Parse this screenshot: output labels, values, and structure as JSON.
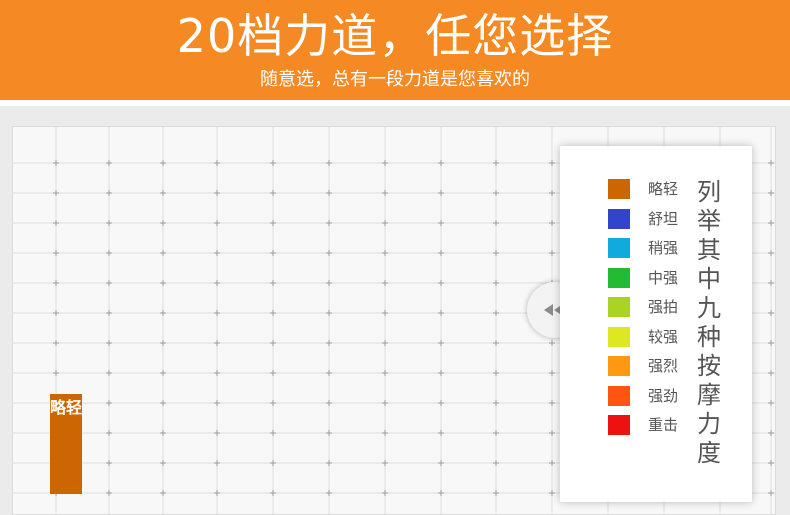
{
  "banner": {
    "title": "20档力道，任您选择",
    "subtitle": "随意选，总有一段力道是您喜欢的",
    "color": "#f58a25"
  },
  "level_bar": {
    "label": "略轻",
    "color": "#cc6600"
  },
  "legend": {
    "caption": "列举其中九种按摩力度",
    "items": [
      {
        "label": "略轻",
        "color": "#cc6600"
      },
      {
        "label": "舒坦",
        "color": "#3344cc"
      },
      {
        "label": "稍强",
        "color": "#11aadd"
      },
      {
        "label": "中强",
        "color": "#22bb33"
      },
      {
        "label": "强拍",
        "color": "#aad422"
      },
      {
        "label": "较强",
        "color": "#dde822"
      },
      {
        "label": "强烈",
        "color": "#ff9911"
      },
      {
        "label": "强劲",
        "color": "#ff5511"
      },
      {
        "label": "重击",
        "color": "#ee1111"
      }
    ]
  },
  "toggle": {
    "icon": "double-chevron-left-icon"
  }
}
